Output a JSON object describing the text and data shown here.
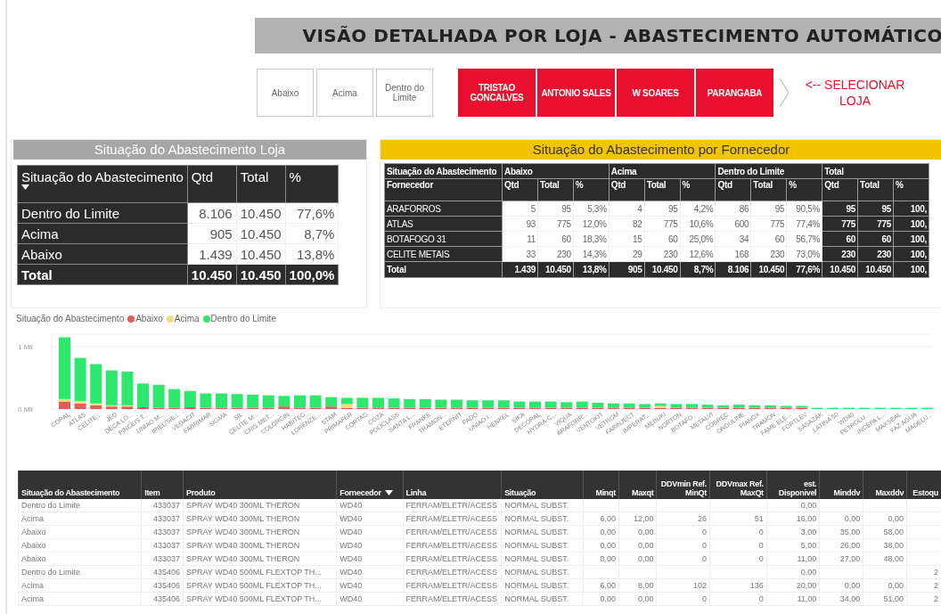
{
  "title": "VISÃO DETALHADA POR LOJA - ABASTECIMENTO AUTOMÁTICO",
  "status_filter": [
    {
      "label": "Abaixo",
      "selected": false
    },
    {
      "label": "Acima",
      "selected": false
    },
    {
      "label": "Dentro do Limite",
      "selected": false
    }
  ],
  "store_filter": [
    {
      "label": "TRISTAO GONCALVES",
      "selected": true
    },
    {
      "label": "ANTONIO SALES",
      "selected": true
    },
    {
      "label": "W SOARES",
      "selected": true
    },
    {
      "label": "PARANGABA",
      "selected": true
    }
  ],
  "store_hint": "<-- SELECIONAR LOJA",
  "store_table": {
    "title": "Situação do Abastecimento Loja",
    "columns": [
      "Situação do Abastecimento",
      "Qtd",
      "Total",
      "%"
    ],
    "rows": [
      [
        "Dentro do Limite",
        "8.106",
        "10.450",
        "77,6%"
      ],
      [
        "Acima",
        "905",
        "10.450",
        "8,7%"
      ],
      [
        "Abaixo",
        "1.439",
        "10.450",
        "13,8%"
      ]
    ],
    "total": [
      "Total",
      "10.450",
      "10.450",
      "100,0%"
    ]
  },
  "supplier_table": {
    "title": "Situação do Abastecimento por Fornecedor",
    "group_label": "Situação do Abastecimento",
    "groups": [
      "Abaixo",
      "Acima",
      "Dentro do Limite",
      "Total"
    ],
    "columns": [
      "Fornecedor",
      "Qtd",
      "Total",
      "%",
      "Qtd",
      "Total",
      "%",
      "Qtd",
      "Total",
      "%",
      "Qtd",
      "Total",
      "%"
    ],
    "rows": [
      [
        "ARAFORROS",
        "5",
        "95",
        "5,3%",
        "4",
        "95",
        "4,2%",
        "86",
        "95",
        "90,5%",
        "95",
        "95",
        "100,"
      ],
      [
        "ATLAS",
        "93",
        "775",
        "12,0%",
        "82",
        "775",
        "10,6%",
        "600",
        "775",
        "77,4%",
        "775",
        "775",
        "100,"
      ],
      [
        "BOTAFOGO 31",
        "11",
        "60",
        "18,3%",
        "15",
        "60",
        "25,0%",
        "34",
        "60",
        "56,7%",
        "60",
        "60",
        "100,"
      ],
      [
        "CELITE METAIS",
        "33",
        "230",
        "14,3%",
        "29",
        "230",
        "12,6%",
        "168",
        "230",
        "73,0%",
        "230",
        "230",
        "100,"
      ]
    ],
    "total": [
      "Total",
      "1.439",
      "10.450",
      "13,8%",
      "905",
      "10.450",
      "8,7%",
      "8.106",
      "10.450",
      "77,6%",
      "10.450",
      "10.450",
      "100,"
    ]
  },
  "chart": {
    "legend_title": "Situação do Abastecimento",
    "chart_data": {
      "type": "bar",
      "stacked": true,
      "categories": [
        "CORAL",
        "ATLAS",
        "CELITE...",
        "JED",
        "DECA LO...",
        "PINCEIS T...",
        "UNIAO M...",
        "IRIEL/SIE...",
        "VEDACIT",
        "FABRIMAR",
        "SIGMA",
        "SIL",
        "CELITE M...",
        "CRIS MET...",
        "COLORGIN",
        "HABITEC",
        "LORENZE...",
        "STAM",
        "PRIMAFER",
        "CORTAG",
        "COZA",
        "POLICLASS",
        "SANTA L...",
        "FRANKE",
        "TRAMON...",
        "ETERNIT",
        "PADO",
        "UNIAO I...",
        "HENKEL",
        "SIKA",
        "DECORAL",
        "HYDRA-C...",
        "VIQUA",
        "ARAFORR...",
        "VENTOKIT",
        "VETROM",
        "FABINJECT",
        "IMPERAT...",
        "MEBUKI",
        "NORTON",
        "BOTAFO...",
        "METALVI",
        "COBREC",
        "ONDULINE",
        "PIANOX",
        "TRAMON",
        "FAME ELE...",
        "FORTLEV",
        "SASAZAK",
        "LATINA 50",
        "WD40",
        "PETROLU...",
        "INCEPA L...",
        "MAXSEAL",
        "FAZ AGUA",
        "MADELU..."
      ],
      "series": [
        {
          "name": "Abaixo",
          "color": "#e35b5b",
          "values": [
            0.12,
            0.09,
            0.06,
            0.04,
            0.04,
            0.03,
            0.02,
            0.02,
            0.03,
            0.02,
            0.02,
            0.02,
            0.02,
            0.02,
            0.04,
            0.02,
            0.02,
            0.04,
            0.02,
            0.02,
            0.02,
            0.02,
            0.02,
            0.02,
            0.02,
            0.02,
            0.02,
            0.02,
            0.02,
            0.02,
            0.02,
            0.02,
            0.02,
            0.02,
            0.02,
            0.02,
            0.02,
            0.02,
            0.02,
            0.02,
            0.02,
            0.02,
            0.02,
            0.02,
            0.02,
            0.02,
            0.02,
            0.02,
            0,
            0,
            0,
            0,
            0,
            0,
            0,
            0
          ]
        },
        {
          "name": "Acima",
          "color": "#f0dc78",
          "values": [
            0.04,
            0.04,
            0.03,
            0.02,
            0.02,
            0,
            0,
            0,
            0,
            0,
            0,
            0,
            0,
            0,
            0,
            0,
            0,
            0,
            0.06,
            0,
            0,
            0,
            0,
            0,
            0,
            0,
            0,
            0,
            0,
            0,
            0,
            0,
            0,
            0,
            0,
            0,
            0,
            0,
            0.03,
            0,
            0,
            0,
            0,
            0,
            0,
            0,
            0,
            0,
            0,
            0,
            0,
            0,
            0,
            0,
            0,
            0
          ]
        },
        {
          "name": "Dentro do Limite",
          "color": "#2ee86e",
          "values": [
            0.99,
            0.69,
            0.63,
            0.56,
            0.54,
            0.38,
            0.37,
            0.3,
            0.26,
            0.23,
            0.23,
            0.22,
            0.21,
            0.2,
            0.17,
            0.2,
            0.2,
            0.15,
            0.1,
            0.16,
            0.16,
            0.15,
            0.14,
            0.14,
            0.13,
            0.13,
            0.12,
            0.12,
            0.12,
            0.1,
            0.1,
            0.1,
            0.09,
            0.1,
            0.08,
            0.07,
            0.07,
            0.06,
            0.04,
            0.06,
            0.06,
            0.05,
            0.04,
            0.05,
            0.04,
            0.04,
            0.03,
            0.03,
            0.02,
            0.02,
            0.02,
            0.02,
            0.02,
            0.02,
            0.02,
            0.02
          ]
        }
      ],
      "ylim": [
        0,
        1.2
      ],
      "yticks": [
        {
          "value": 0,
          "label": "0 Mil"
        },
        {
          "value": 1,
          "label": "1 Mil"
        }
      ]
    }
  },
  "detail_table": {
    "columns": [
      "Situação do Abastecimento",
      "Item",
      "Produto",
      "Fornecedor",
      "Linha",
      "Situação",
      "Minqt",
      "Maxqt",
      "DDVmin Ref. MinQt",
      "DDVmax Ref. MaxQt",
      "est. Disponivel",
      "Minddv",
      "Maxddv",
      "Estoqu"
    ],
    "rows": [
      [
        "Dentro do Limite",
        "433037",
        "SPRAY WD40 300ML THERON",
        "WD40",
        "FERRAM/ELETR/ACESS",
        "NORMAL SUBST.",
        null,
        null,
        null,
        null,
        "0,00",
        null,
        null,
        null
      ],
      [
        "Acima",
        "433037",
        "SPRAY WD40 300ML THERON",
        "WD40",
        "FERRAM/ELETR/ACESS",
        "NORMAL SUBST.",
        "6,00",
        "12,00",
        "26",
        "51",
        "16,00",
        "0,00",
        "0,00",
        null
      ],
      [
        "Abaixo",
        "433037",
        "SPRAY WD40 300ML THERON",
        "WD40",
        "FERRAM/ELETR/ACESS",
        "NORMAL SUBST.",
        "0,00",
        "0,00",
        "0",
        "0",
        "3,00",
        "35,00",
        "58,00",
        null
      ],
      [
        "Abaixo",
        "433037",
        "SPRAY WD40 300ML THERON",
        "WD40",
        "FERRAM/ELETR/ACESS",
        "NORMAL SUBST.",
        "0,00",
        "0,00",
        "0",
        "0",
        "5,00",
        "26,00",
        "38,00",
        null
      ],
      [
        "Abaixo",
        "433037",
        "SPRAY WD40 300ML THERON",
        "WD40",
        "FERRAM/ELETR/ACESS",
        "NORMAL SUBST.",
        "0,00",
        "0,00",
        "0",
        "0",
        "11,00",
        "27,00",
        "48,00",
        null
      ],
      [
        "Dentro do Limite",
        "435406",
        "SPRAY WD40 500ML FLEXTOP TH...",
        "WD40",
        "FERRAM/ELETR/ACESS",
        "NORMAL SUBST.",
        null,
        null,
        null,
        null,
        "0,00",
        null,
        null,
        "2"
      ],
      [
        "Acima",
        "435406",
        "SPRAY WD40 500ML FLEXTOP TH...",
        "WD40",
        "FERRAM/ELETR/ACESS",
        "NORMAL SUBST.",
        "6,00",
        "8,00",
        "102",
        "136",
        "20,00",
        "0,00",
        "0,00",
        "2"
      ],
      [
        "Acima",
        "435406",
        "SPRAY WD40 500ML FLEXTOP TH...",
        "WD40",
        "FERRAM/ELETR/ACESS",
        "NORMAL SUBST.",
        "0,00",
        "0,00",
        "0",
        "0",
        "11,00",
        "34,00",
        "51,00",
        "2"
      ]
    ]
  }
}
